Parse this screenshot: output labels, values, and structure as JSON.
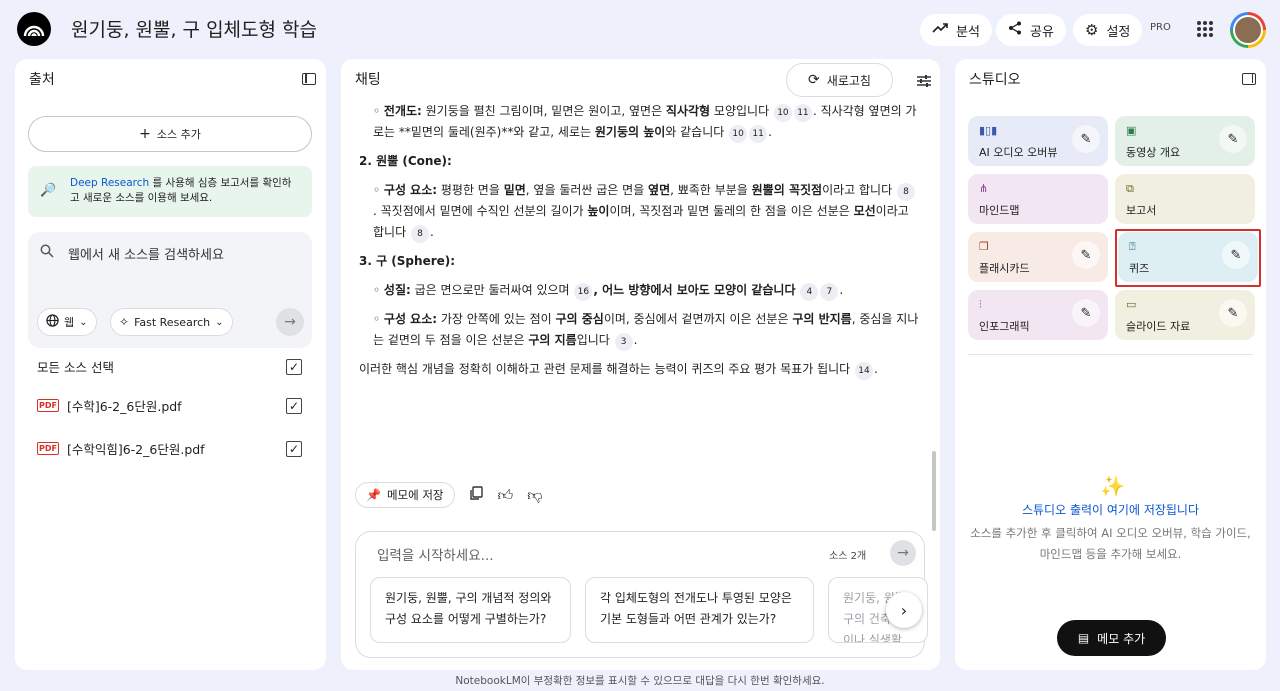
{
  "header": {
    "title": "원기둥, 원뿔, 구 입체도형 학습",
    "analyze": "분석",
    "share": "공유",
    "settings": "설정",
    "pro": "PRO"
  },
  "sources": {
    "title": "출처",
    "add_label": "소스 추가",
    "deep_link": "Deep Research",
    "deep_text": " 를 사용해 심층 보고서를 확인하고 새로운 소스를 이용해 보세요.",
    "search_placeholder": "웹에서 새 소스를 검색하세요",
    "web_chip": "웹",
    "research_chip": "Fast Research",
    "select_all": "모든 소스 선택",
    "files": [
      "[수학]6-2_6단원.pdf",
      "[수학익힘]6-2_6단원.pdf"
    ],
    "pdf_badge": "PDF"
  },
  "chat": {
    "title": "채팅",
    "refresh": "새로고침",
    "save_memo": "메모에 저장",
    "input_placeholder": "입력을 시작하세요...",
    "source_count": "소스 2개",
    "suggestions": [
      "원기둥, 원뿔, 구의 개념적 정의와 구성 요소를 어떻게 구별하는가?",
      "각 입체도형의 전개도나 투영된 모양은 기본 도형들과 어떤 관계가 있는가?",
      "원기둥, 원뿔, 구의 건축물이나 실생활"
    ],
    "paragraphs": {
      "p1_label": "전개도:",
      "p1_a": " 원기둥을 펼친 그림이며, 밑면은 원이고, 옆면은 ",
      "p1_b": "직사각형",
      "p1_c": " 모양입니다 ",
      "p1_d": ". 직사각형 옆면의 가로는 **밑면의 둘레(원주)**와 같고, 세로는 ",
      "p1_e": "원기둥의 높이",
      "p1_f": "와 같습니다 ",
      "cone_head": "2. 원뿔 (Cone):",
      "p2_label": "구성 요소:",
      "p2_a": " 평평한 면을 ",
      "p2_b": "밑면",
      "p2_c": ", 옆을 둘러싼 굽은 면을 ",
      "p2_d": "옆면",
      "p2_e": ", 뾰족한 부분을 ",
      "p2_f": "원뿔의 꼭짓점",
      "p2_g": "이라고 합니다 ",
      "p2_h": ". 꼭짓점에서 밑면에 수직인 선분의 길이가 ",
      "p2_i": "높이",
      "p2_j": "이며, 꼭짓점과 밑면 둘레의 한 점을 이은 선분은 ",
      "p2_k": "모선",
      "p2_l": "이라고 합니다 ",
      "sphere_head": "3. 구 (Sphere):",
      "p3_label": "성질:",
      "p3_a": " 굽은 면으로만 둘러싸여 있으며 ",
      "p3_b": ", 어느 방향에서 보아도 모양이 같습니다",
      "p4_label": "구성 요소:",
      "p4_a": " 가장 안쪽에 있는 점이 ",
      "p4_b": "구의 중심",
      "p4_c": "이며, 중심에서 겉면까지 이은 선분은 ",
      "p4_d": "구의 반지름",
      "p4_e": ", 중심을 지나는 겉면의 두 점을 이은 선분은 ",
      "p4_f": "구의 지름",
      "p4_g": "입니다 ",
      "p5_a": "이러한 핵심 개념을 정확히 이해하고 관련 문제를 해결하는 능력이 퀴즈의 주요 평가 목표가 됩니다 ",
      "refs": [
        "10",
        "11",
        "10",
        "11",
        "8",
        "8",
        "16",
        "4",
        "7",
        "3",
        "14"
      ]
    }
  },
  "studio": {
    "title": "스튜디오",
    "tiles": [
      {
        "label": "AI 오디오 오버뷰",
        "color": "#e6ebf7"
      },
      {
        "label": "동영상 개요",
        "color": "#e3f0e7"
      },
      {
        "label": "마인드맵",
        "color": "#f1e6f2"
      },
      {
        "label": "보고서",
        "color": "#f1efe0"
      },
      {
        "label": "플래시카드",
        "color": "#f8ebe6"
      },
      {
        "label": "퀴즈",
        "color": "#deeff3"
      },
      {
        "label": "인포그래픽",
        "color": "#f1e6f2"
      },
      {
        "label": "슬라이드 자료",
        "color": "#f1efe0"
      }
    ],
    "empty_title": "스튜디오 출력이 여기에 저장됩니다",
    "empty_desc": "소스를 추가한 후 클릭하여 AI 오디오 오버뷰, 학습 가이드, 마인드맵 등을 추가해 보세요.",
    "add_memo": "메모 추가"
  },
  "footer": "NotebookLM이 부정확한 정보를 표시할 수 있으므로 대답을 다시 한번 확인하세요."
}
